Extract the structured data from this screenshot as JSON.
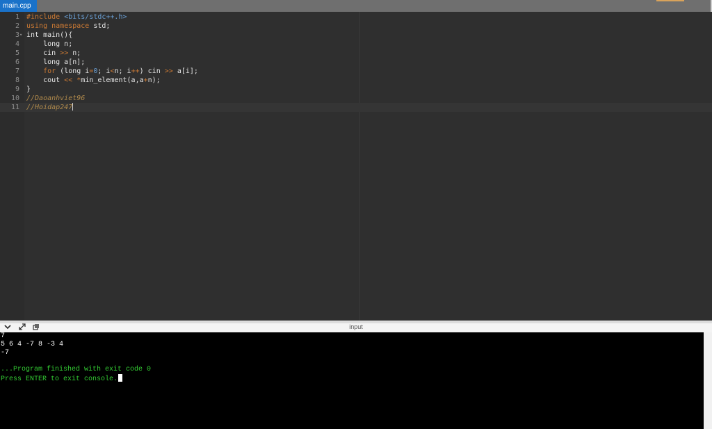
{
  "tab": {
    "label": "main.cpp"
  },
  "editor": {
    "lines": [
      {
        "n": "1",
        "tokens": [
          {
            "c": "pp",
            "t": "#include "
          },
          {
            "c": "str",
            "t": "<bits/stdc++.h>"
          }
        ]
      },
      {
        "n": "2",
        "tokens": [
          {
            "c": "kw",
            "t": "using"
          },
          {
            "c": "",
            "t": " "
          },
          {
            "c": "kw",
            "t": "namespace"
          },
          {
            "c": "",
            "t": " std;"
          }
        ]
      },
      {
        "n": "3",
        "fold": true,
        "tokens": [
          {
            "c": "",
            "t": "int main(){"
          }
        ]
      },
      {
        "n": "4",
        "tokens": [
          {
            "c": "",
            "t": "    long n;"
          }
        ]
      },
      {
        "n": "5",
        "tokens": [
          {
            "c": "",
            "t": "    cin "
          },
          {
            "c": "op",
            "t": ">>"
          },
          {
            "c": "",
            "t": " n;"
          }
        ]
      },
      {
        "n": "6",
        "tokens": [
          {
            "c": "",
            "t": "    long a[n];"
          }
        ]
      },
      {
        "n": "7",
        "tokens": [
          {
            "c": "",
            "t": "    "
          },
          {
            "c": "kw",
            "t": "for"
          },
          {
            "c": "",
            "t": " (long i"
          },
          {
            "c": "op",
            "t": "="
          },
          {
            "c": "num",
            "t": "0"
          },
          {
            "c": "",
            "t": "; i"
          },
          {
            "c": "op",
            "t": "<"
          },
          {
            "c": "",
            "t": "n; i"
          },
          {
            "c": "op",
            "t": "++"
          },
          {
            "c": "",
            "t": ") cin "
          },
          {
            "c": "op",
            "t": ">>"
          },
          {
            "c": "",
            "t": " a[i];"
          }
        ]
      },
      {
        "n": "8",
        "tokens": [
          {
            "c": "",
            "t": "    cout "
          },
          {
            "c": "op",
            "t": "<<"
          },
          {
            "c": "",
            "t": " "
          },
          {
            "c": "op",
            "t": "*"
          },
          {
            "c": "",
            "t": "min_element(a,a"
          },
          {
            "c": "op",
            "t": "+"
          },
          {
            "c": "",
            "t": "n);"
          }
        ]
      },
      {
        "n": "9",
        "tokens": [
          {
            "c": "",
            "t": "}"
          }
        ]
      },
      {
        "n": "10",
        "tokens": [
          {
            "c": "cm",
            "t": "//Daoanhviet96"
          }
        ]
      },
      {
        "n": "11",
        "active": true,
        "tokens": [
          {
            "c": "cm",
            "t": "//Hoidap247"
          }
        ]
      }
    ]
  },
  "console": {
    "title": "input",
    "icons": [
      "chevron-down-icon",
      "expand-icon",
      "copy-icon"
    ],
    "lines": [
      {
        "t": "7",
        "green": false
      },
      {
        "t": "5 6 4 -7 8 -3 4",
        "green": false
      },
      {
        "t": "-7",
        "green": false
      },
      {
        "t": "",
        "green": false
      },
      {
        "t": "...Program finished with exit code 0",
        "green": true
      },
      {
        "t": "Press ENTER to exit console.",
        "green": true,
        "cursor": true
      }
    ]
  },
  "colors": {
    "tab_active": "#1a72c9",
    "keyword": "#cc7a34",
    "string": "#6a9fd4",
    "comment": "#b08a4c",
    "console_green": "#33cc33"
  }
}
